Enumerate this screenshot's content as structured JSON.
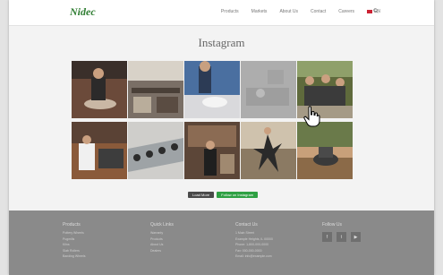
{
  "header": {
    "logo": "Nidec",
    "nav": [
      "Products",
      "Markets",
      "About Us",
      "Contact",
      "Careers",
      "EN"
    ]
  },
  "page": {
    "title": "Instagram"
  },
  "gallery": {
    "tiles": [
      {
        "name": "tile-potter-wheel",
        "color": "#6b4a3a"
      },
      {
        "name": "tile-workshop-tables",
        "color": "#7a6f66"
      },
      {
        "name": "tile-studio-blue",
        "color": "#4a6fa0"
      },
      {
        "name": "tile-hovered",
        "color": "#9e9e9e"
      },
      {
        "name": "tile-group-outdoor",
        "color": "#5f6a3c"
      },
      {
        "name": "tile-kiln-worker",
        "color": "#8a5a3a"
      },
      {
        "name": "tile-wheels-row",
        "color": "#b9b8b4"
      },
      {
        "name": "tile-shop-door",
        "color": "#5c4638"
      },
      {
        "name": "tile-dancer",
        "color": "#8b7a63"
      },
      {
        "name": "tile-pottery-bowl",
        "color": "#c8a07a"
      }
    ]
  },
  "buttons": {
    "load_more": "Load More",
    "follow": "Follow on Instagram"
  },
  "footer": {
    "products": {
      "title": "Products",
      "items": [
        "Pottery Wheels",
        "Pugmills",
        "Kilns",
        "Slab Rollers",
        "Banding Wheels"
      ]
    },
    "quick_links": {
      "title": "Quick Links",
      "items": [
        "Warranty",
        "Products",
        "About Us",
        "Dealers"
      ]
    },
    "contact": {
      "title": "Contact Us",
      "items": [
        "1 Main Street",
        "Example Heights, IL 00000",
        "Phone: 1-800-000-0000",
        "Fax: 000-000-0000",
        "Email: info@example.com"
      ]
    },
    "follow": {
      "title": "Follow Us",
      "icons": [
        "f",
        "t",
        "▶"
      ]
    }
  }
}
